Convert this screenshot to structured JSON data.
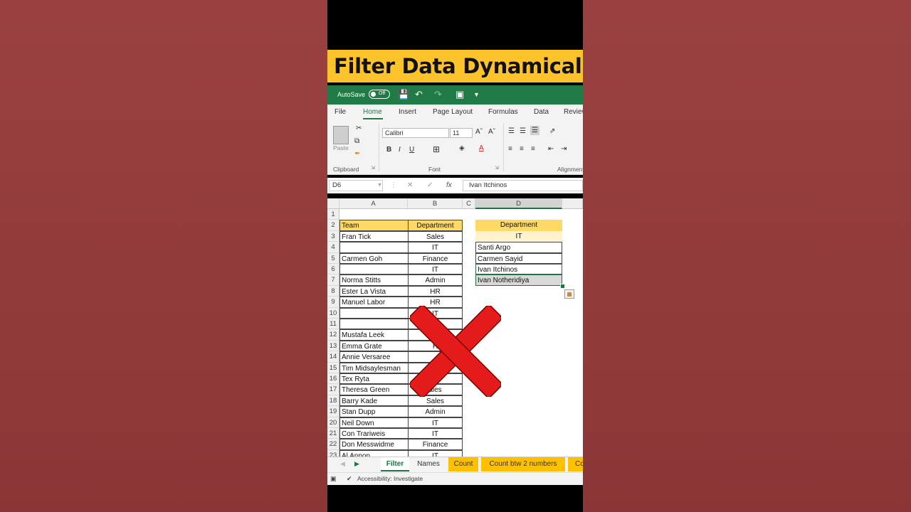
{
  "title": "Filter Data Dynamically",
  "qat": {
    "autosave": "AutoSave",
    "toggle": "Off"
  },
  "menu": [
    "File",
    "Home",
    "Insert",
    "Page Layout",
    "Formulas",
    "Data",
    "Review"
  ],
  "ribbon": {
    "paste": "Paste",
    "font_name": "Calibri",
    "font_size": "11",
    "groups": {
      "clipboard": "Clipboard",
      "font": "Font",
      "alignment": "Alignment"
    }
  },
  "formula_bar": {
    "name_box": "D6",
    "formula": "Ivan Itchinos"
  },
  "columns": [
    "A",
    "B",
    "C",
    "D"
  ],
  "rows": [
    "1",
    "2",
    "3",
    "4",
    "5",
    "6",
    "7",
    "8",
    "9",
    "10",
    "11",
    "12",
    "13",
    "14",
    "15",
    "16",
    "17",
    "18",
    "19",
    "20",
    "21",
    "22",
    "23"
  ],
  "table": {
    "headers": {
      "team": "Team",
      "department": "Department"
    },
    "team": [
      "Fran Tick",
      "",
      "Carmen Goh",
      "",
      "Norma Stitts",
      "Ester La Vista",
      "Manuel Labor",
      "",
      "",
      "Mustafa Leek",
      "Emma Grate",
      "Annie Versaree",
      "Tim Midsaylesman",
      "Tex Ryta",
      "Theresa Green",
      "Barry Kade",
      "Stan Dupp",
      "Neil Down",
      "Con Trariweis",
      "Don Messwidme",
      "Al Annon"
    ],
    "department": [
      "Sales",
      "IT",
      "Finance",
      "IT",
      "Admin",
      "HR",
      "HR",
      "IT",
      "",
      "",
      "H",
      "",
      "",
      "n",
      "ales",
      "Sales",
      "Admin",
      "IT",
      "IT",
      "Finance",
      "IT"
    ]
  },
  "filter_panel": {
    "header": "Department",
    "criteria": "IT",
    "results": [
      "Santi Argo",
      "Carmen Sayid",
      "Ivan Itchinos",
      "Ivan Notheridiya"
    ]
  },
  "sheet_tabs": [
    "Filter",
    "Names",
    "Count",
    "Count btw 2 numbers",
    "Co"
  ],
  "status": "Accessibility: Investigate",
  "colors": {
    "accent": "#217346",
    "header_yellow": "#ffd966",
    "title_bg": "#fdc32d",
    "cross": "#e51b1b"
  }
}
